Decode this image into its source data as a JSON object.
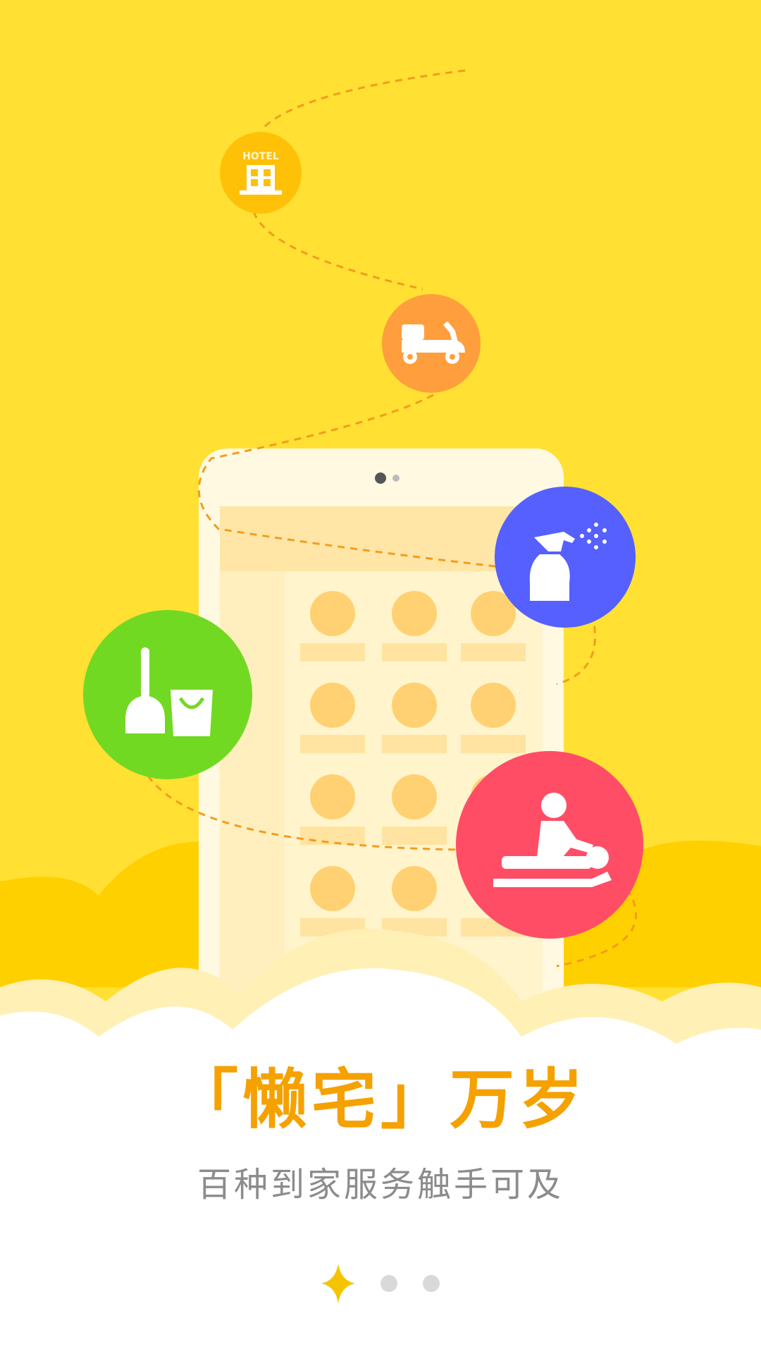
{
  "onboarding": {
    "headline": "「懒宅」万岁",
    "subheadline": "百种到家服务触手可及",
    "page_indicator": {
      "total": 3,
      "current": 1
    }
  },
  "services": [
    {
      "name": "hotel",
      "label": "HOTEL",
      "icon": "hotel-building-icon",
      "color": "#FFC107"
    },
    {
      "name": "delivery",
      "icon": "scooter-icon",
      "color": "#FF9E3D"
    },
    {
      "name": "cleaning-spray",
      "icon": "spray-bottle-icon",
      "color": "#5560FF"
    },
    {
      "name": "housekeeping",
      "icon": "broom-bucket-icon",
      "color": "#72D923"
    },
    {
      "name": "massage",
      "icon": "massage-icon",
      "color": "#FF4D66"
    }
  ],
  "colors": {
    "background": "#FFE033",
    "accent": "#F5A100",
    "subtitle": "#8c8c8c"
  }
}
